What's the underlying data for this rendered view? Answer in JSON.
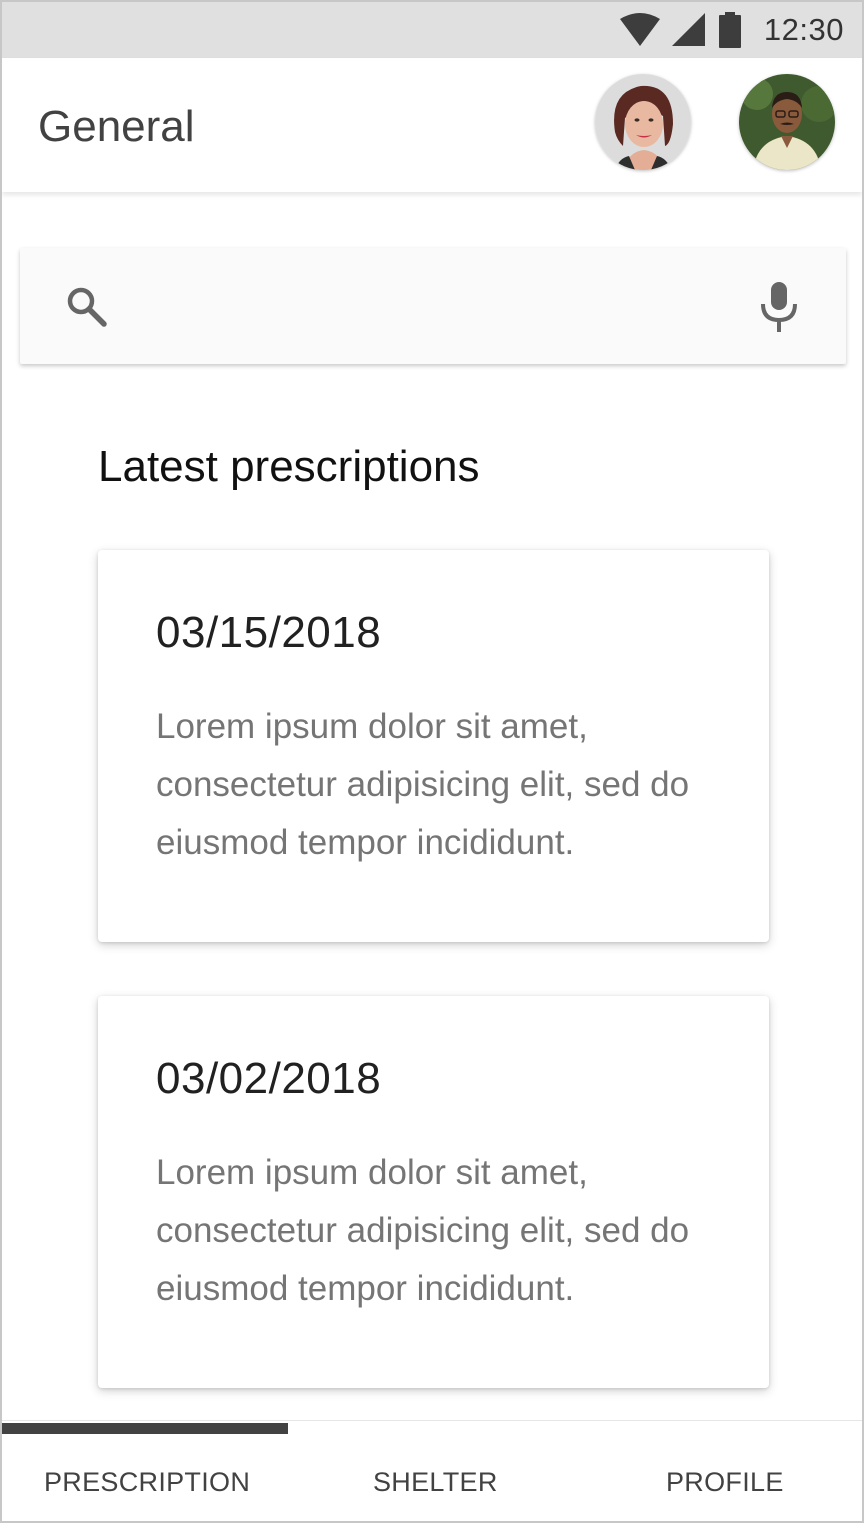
{
  "status_bar": {
    "time": "12:30",
    "icons": [
      "wifi-icon",
      "cellular-signal-icon",
      "battery-icon"
    ]
  },
  "app_bar": {
    "title": "General",
    "avatars": [
      {
        "name": "avatar-woman"
      },
      {
        "name": "avatar-man"
      }
    ]
  },
  "search": {
    "placeholder": "",
    "value": "",
    "icons": [
      "search-icon",
      "microphone-icon"
    ]
  },
  "main": {
    "section_title": "Latest prescriptions",
    "cards": [
      {
        "date": "03/15/2018",
        "text": "Lorem ipsum dolor sit amet, consectetur adipisicing elit, sed do eiusmod tempor incididunt."
      },
      {
        "date": "03/02/2018",
        "text": "Lorem ipsum dolor sit amet, consectetur adipisicing elit, sed do eiusmod tempor incididunt."
      }
    ]
  },
  "bottom_nav": {
    "tabs": [
      {
        "label": "PRESCRIPTION",
        "active": true
      },
      {
        "label": "SHELTER",
        "active": false
      },
      {
        "label": "PROFILE",
        "active": false
      }
    ]
  },
  "colors": {
    "status_bar": "#e0e0e0",
    "text_primary": "#212121",
    "text_secondary": "#757575",
    "indicator": "#424242"
  }
}
